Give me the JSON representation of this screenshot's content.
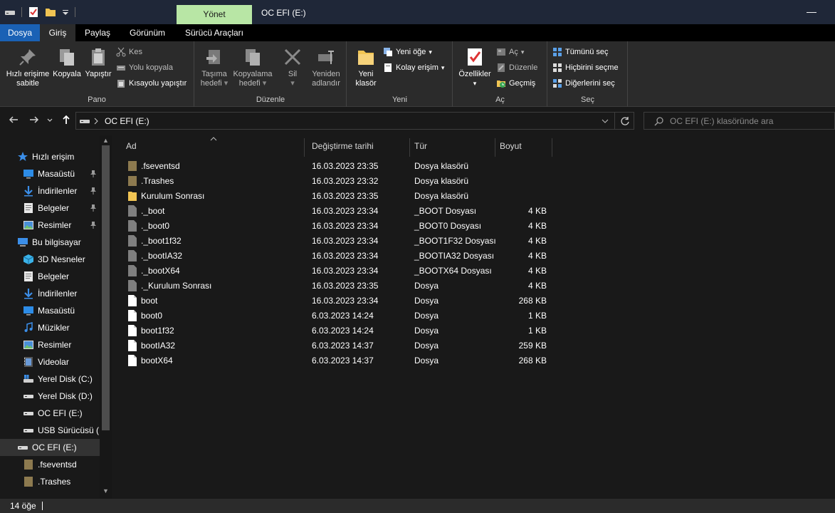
{
  "window": {
    "title": "OC EFI (E:)",
    "context_tab": "Yönet",
    "minimize_glyph": "—"
  },
  "ribbon_tabs": [
    "Dosya",
    "Giriş",
    "Paylaş",
    "Görünüm",
    "Sürücü Araçları"
  ],
  "ribbon": {
    "pano": {
      "label": "Pano",
      "pin_quick": "Hızlı erişime sabitle",
      "pin_quick_l1": "Hızlı erişime",
      "pin_quick_l2": "sabitle",
      "copy": "Kopyala",
      "paste": "Yapıştır",
      "cut": "Kes",
      "copy_path": "Yolu kopyala",
      "paste_shortcut": "Kısayolu yapıştır"
    },
    "duzenle": {
      "label": "Düzenle",
      "move_l1": "Taşıma",
      "move_l2": "hedefi",
      "copyto_l1": "Kopyalama",
      "copyto_l2": "hedefi",
      "delete": "Sil",
      "rename_l1": "Yeniden",
      "rename_l2": "adlandır"
    },
    "yeni": {
      "label": "Yeni",
      "newfolder_l1": "Yeni",
      "newfolder_l2": "klasör",
      "new_item": "Yeni öğe",
      "easy_access": "Kolay erişim"
    },
    "ac": {
      "label": "Aç",
      "properties": "Özellikler",
      "open": "Aç",
      "edit": "Düzenle",
      "history": "Geçmiş"
    },
    "sec": {
      "label": "Seç",
      "select_all": "Tümünü seç",
      "select_none": "Hiçbirini seçme",
      "invert": "Diğerlerini seç"
    }
  },
  "address": {
    "path": "OC EFI (E:)",
    "search_placeholder": "OC EFI (E:) klasöründe ara"
  },
  "nav": [
    {
      "label": "Hızlı erişim",
      "icon": "star-icon",
      "indent": 0,
      "pinned": false
    },
    {
      "label": "Masaüstü",
      "icon": "desktop-icon",
      "indent": 1,
      "pinned": true
    },
    {
      "label": "İndirilenler",
      "icon": "download-icon",
      "indent": 1,
      "pinned": true
    },
    {
      "label": "Belgeler",
      "icon": "document-icon",
      "indent": 1,
      "pinned": true
    },
    {
      "label": "Resimler",
      "icon": "pictures-icon",
      "indent": 1,
      "pinned": true
    },
    {
      "label": "Bu bilgisayar",
      "icon": "computer-icon",
      "indent": 0,
      "pinned": false
    },
    {
      "label": "3D Nesneler",
      "icon": "cube-icon",
      "indent": 1,
      "pinned": false
    },
    {
      "label": "Belgeler",
      "icon": "document-icon",
      "indent": 1,
      "pinned": false
    },
    {
      "label": "İndirilenler",
      "icon": "download-icon",
      "indent": 1,
      "pinned": false
    },
    {
      "label": "Masaüstü",
      "icon": "desktop-icon",
      "indent": 1,
      "pinned": false
    },
    {
      "label": "Müzikler",
      "icon": "music-icon",
      "indent": 1,
      "pinned": false
    },
    {
      "label": "Resimler",
      "icon": "pictures-icon",
      "indent": 1,
      "pinned": false
    },
    {
      "label": "Videolar",
      "icon": "video-icon",
      "indent": 1,
      "pinned": false
    },
    {
      "label": "Yerel Disk (C:)",
      "icon": "system-drive-icon",
      "indent": 1,
      "pinned": false
    },
    {
      "label": "Yerel Disk (D:)",
      "icon": "drive-icon",
      "indent": 1,
      "pinned": false
    },
    {
      "label": "OC EFI (E:)",
      "icon": "drive-icon",
      "indent": 1,
      "pinned": false
    },
    {
      "label": "USB Sürücüsü (F",
      "icon": "drive-icon",
      "indent": 1,
      "pinned": false
    },
    {
      "label": "OC EFI (E:)",
      "icon": "drive-icon",
      "indent": 0,
      "pinned": false,
      "selected": true
    },
    {
      "label": ".fseventsd",
      "icon": "folder-hidden-icon",
      "indent": 1,
      "pinned": false
    },
    {
      "label": ".Trashes",
      "icon": "folder-hidden-icon",
      "indent": 1,
      "pinned": false
    }
  ],
  "columns": {
    "name": "Ad",
    "date": "Değiştirme tarihi",
    "type": "Tür",
    "size": "Boyut"
  },
  "files": [
    {
      "name": ".fseventsd",
      "date": "16.03.2023 23:35",
      "type": "Dosya klasörü",
      "size": "",
      "kind": "folder-hidden"
    },
    {
      "name": ".Trashes",
      "date": "16.03.2023 23:32",
      "type": "Dosya klasörü",
      "size": "",
      "kind": "folder-hidden"
    },
    {
      "name": "Kurulum Sonrası",
      "date": "16.03.2023 23:35",
      "type": "Dosya klasörü",
      "size": "",
      "kind": "folder"
    },
    {
      "name": "._boot",
      "date": "16.03.2023 23:34",
      "type": "_BOOT Dosyası",
      "size": "4 KB",
      "kind": "file-hidden"
    },
    {
      "name": "._boot0",
      "date": "16.03.2023 23:34",
      "type": "_BOOT0 Dosyası",
      "size": "4 KB",
      "kind": "file-hidden"
    },
    {
      "name": "._boot1f32",
      "date": "16.03.2023 23:34",
      "type": "_BOOT1F32 Dosyası",
      "size": "4 KB",
      "kind": "file-hidden"
    },
    {
      "name": "._bootIA32",
      "date": "16.03.2023 23:34",
      "type": "_BOOTIA32 Dosyası",
      "size": "4 KB",
      "kind": "file-hidden"
    },
    {
      "name": "._bootX64",
      "date": "16.03.2023 23:34",
      "type": "_BOOTX64 Dosyası",
      "size": "4 KB",
      "kind": "file-hidden"
    },
    {
      "name": "._Kurulum Sonrası",
      "date": "16.03.2023 23:35",
      "type": "Dosya",
      "size": "4 KB",
      "kind": "file-hidden"
    },
    {
      "name": "boot",
      "date": "16.03.2023 23:34",
      "type": "Dosya",
      "size": "268 KB",
      "kind": "file"
    },
    {
      "name": "boot0",
      "date": "6.03.2023 14:24",
      "type": "Dosya",
      "size": "1 KB",
      "kind": "file"
    },
    {
      "name": "boot1f32",
      "date": "6.03.2023 14:24",
      "type": "Dosya",
      "size": "1 KB",
      "kind": "file"
    },
    {
      "name": "bootIA32",
      "date": "6.03.2023 14:37",
      "type": "Dosya",
      "size": "259 KB",
      "kind": "file"
    },
    {
      "name": "bootX64",
      "date": "6.03.2023 14:37",
      "type": "Dosya",
      "size": "268 KB",
      "kind": "file"
    }
  ],
  "status": {
    "count": "14 öğe"
  },
  "colors": {
    "accent": "#1a61b5",
    "context_tab": "#b8e6a5",
    "folder": "#f1c453",
    "folder_hidden": "#8d7a4f",
    "background": "#191919"
  }
}
